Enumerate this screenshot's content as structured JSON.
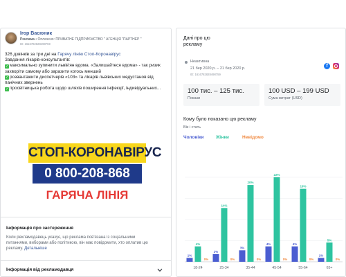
{
  "ad": {
    "advertiser": "Ігор Васюник",
    "sponsored_prefix": "Реклама",
    "paid_by_prefix": "• Оплачено:",
    "paid_by": "ПРИВАТНЕ ПІДПРИЄМСТВО \" АГЕНЦІЯ \"ПАРТНЕР \"",
    "id": "ID: 1616782828498759",
    "text": {
      "line1_prefix": "326 дзвінків за три дні на ",
      "line1_link": "Гарячу лінію Стоп-Коронавірус",
      "line2": "Завдання лікарів-консультантів:",
      "line3": "максимально зупинити львів'ян вдома. «Залишайтеся вдома» - так ризик",
      "line4": "захворіти самому або заразити когось менший",
      "line5": "розвантажити диспетчерів «103» та лікарів львівських медустанов від",
      "line6": "панічних звернень",
      "line7": "просвітницька робота щодо шляхів поширення інфекції, індивідуальних..."
    },
    "banner": {
      "line1": "СТОП-КОРОНАВІРУС",
      "phone": "0 800-208-868",
      "line3": "ГАРЯЧА ЛІНІЯ"
    },
    "disclaimer_title": "Інформація про застереження",
    "disclaimer": {
      "line1": "Коли рекламодавець указує, що реклама пов'язана із соціальними",
      "line2": "питаннями, виборами або політикою, він має повідомити, хто оплатив цю",
      "line3_prefix": "рекламу. ",
      "more_link": "Детальніше"
    },
    "advertiser_info_title": "Інформація від рекламодавця"
  },
  "details": {
    "title_line1": "Дані про цю",
    "title_line2": "рекламу",
    "status": "Неактивна",
    "dates": "21 бер 2020 р. – 21 бер 2020 р.",
    "id": "ID: 1616782828498759",
    "impressions_value": "100 тис. – 125 тис.",
    "impressions_label": "Покази",
    "spend_value": "100 USD – 199 USD",
    "spend_label": "Сума витрат (USD)",
    "shown_title": "Кому було показано цю рекламу",
    "shown_sub": "Вік і стать",
    "icons": {
      "facebook": "facebook-icon",
      "instagram": "instagram-icon"
    }
  },
  "colors": {
    "male": "#4a5dd1",
    "female": "#2ec4a0",
    "unknown": "#f0883e"
  },
  "chart_data": {
    "type": "bar",
    "title": "",
    "xlabel": "",
    "ylabel": "",
    "categories": [
      "18-24",
      "25-34",
      "35-44",
      "45-54",
      "55-64",
      "65+"
    ],
    "series": [
      {
        "name": "Чоловіки",
        "values": [
          1,
          2,
          3,
          4,
          4,
          1
        ],
        "labels": [
          "1%",
          "2%",
          "3%",
          "4%",
          "4%",
          "1%"
        ]
      },
      {
        "name": "Жінки",
        "values": [
          4,
          14,
          20,
          22,
          19,
          5
        ],
        "labels": [
          "4%",
          "14%",
          "20%",
          "22%",
          "19%",
          "5%"
        ]
      },
      {
        "name": "Невідомо",
        "values": [
          0,
          0,
          0,
          0,
          0,
          0
        ],
        "labels": [
          "0%",
          "0%",
          "0%",
          "0%",
          "0%",
          "0%"
        ]
      }
    ],
    "ylim": [
      0,
      22
    ],
    "grid": true,
    "legend_position": "top-left"
  }
}
